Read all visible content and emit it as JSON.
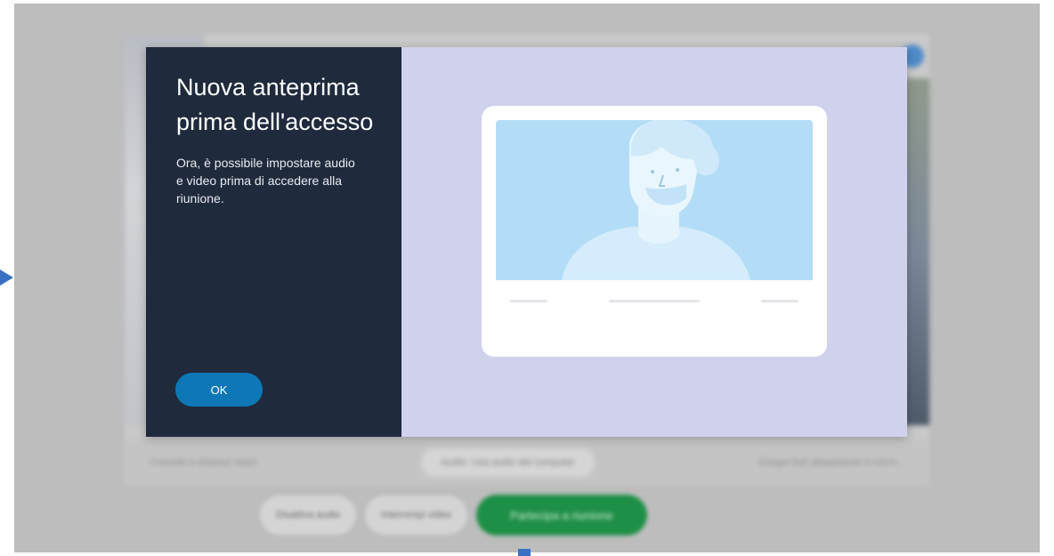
{
  "dialog": {
    "title": "Nuova anteprima prima dell'accesso",
    "description": "Ora, è possibile impostare audio e video prima di accedere alla riunione.",
    "ok_label": "OK",
    "illustration_icon": "person-video-preview-illustration"
  },
  "background": {
    "bottom_bar": {
      "connect_label": "Connetti a sistema video",
      "audio_label": "Audio: Usa audio del computer",
      "test_label": "Esegui test altoparlante e micro..."
    },
    "controls": {
      "mute_label": "Disattiva audio",
      "stop_video_label": "Interrompi video",
      "join_label": "Partecipa a riunione"
    }
  },
  "colors": {
    "dialog_left_bg": "#1f2a3c",
    "dialog_right_bg": "#cfd1ed",
    "ok_button": "#0e78b7",
    "join_button": "#1e8f47",
    "annotation_arrow": "#3a70c4"
  }
}
